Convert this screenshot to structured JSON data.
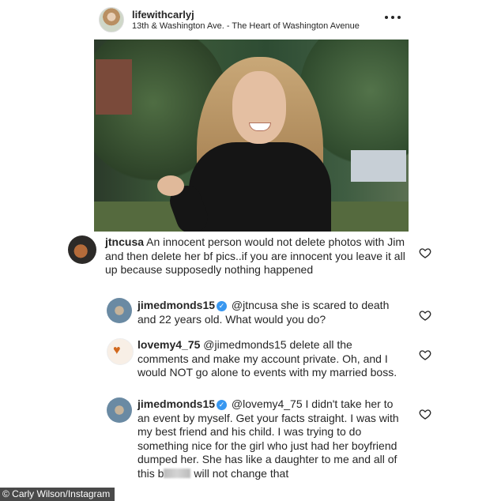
{
  "header": {
    "username": "lifewithcarlyj",
    "location": "13th & Washington Ave. - The Heart of Washington Avenue"
  },
  "icons": {
    "more": "more-options-icon",
    "like": "heart-outline-icon",
    "verified": "verified-badge-icon"
  },
  "colors": {
    "verified": "#3897f0",
    "text": "#262626"
  },
  "comments": [
    {
      "username": "jtncusa",
      "verified": false,
      "mention": "",
      "text": "An innocent person would not delete photos with Jim and then delete her bf pics..if you are innocent you leave it all up because supposedly nothing happened"
    },
    {
      "username": "jimedmonds15",
      "verified": true,
      "mention": "@jtncusa",
      "text": "she is scared to death and 22 years old.  What would you do?"
    },
    {
      "username": "lovemy4_75",
      "verified": false,
      "mention": "@jimedmonds15",
      "text": "delete all the comments and make my account private. Oh, and I would NOT go alone to events with my married boss."
    },
    {
      "username": "jimedmonds15",
      "verified": true,
      "mention": "@lovemy4_75",
      "text": "I didn't take her to an event by myself. Get your facts straight. I was with my best friend and his child.  I was trying to do something nice for the girl who just had her boyfriend dumped her. She has like a daughter to me and all of this b",
      "text_after_blur": " will not change that"
    }
  ],
  "credit": "© Carly Wilson/Instagram"
}
